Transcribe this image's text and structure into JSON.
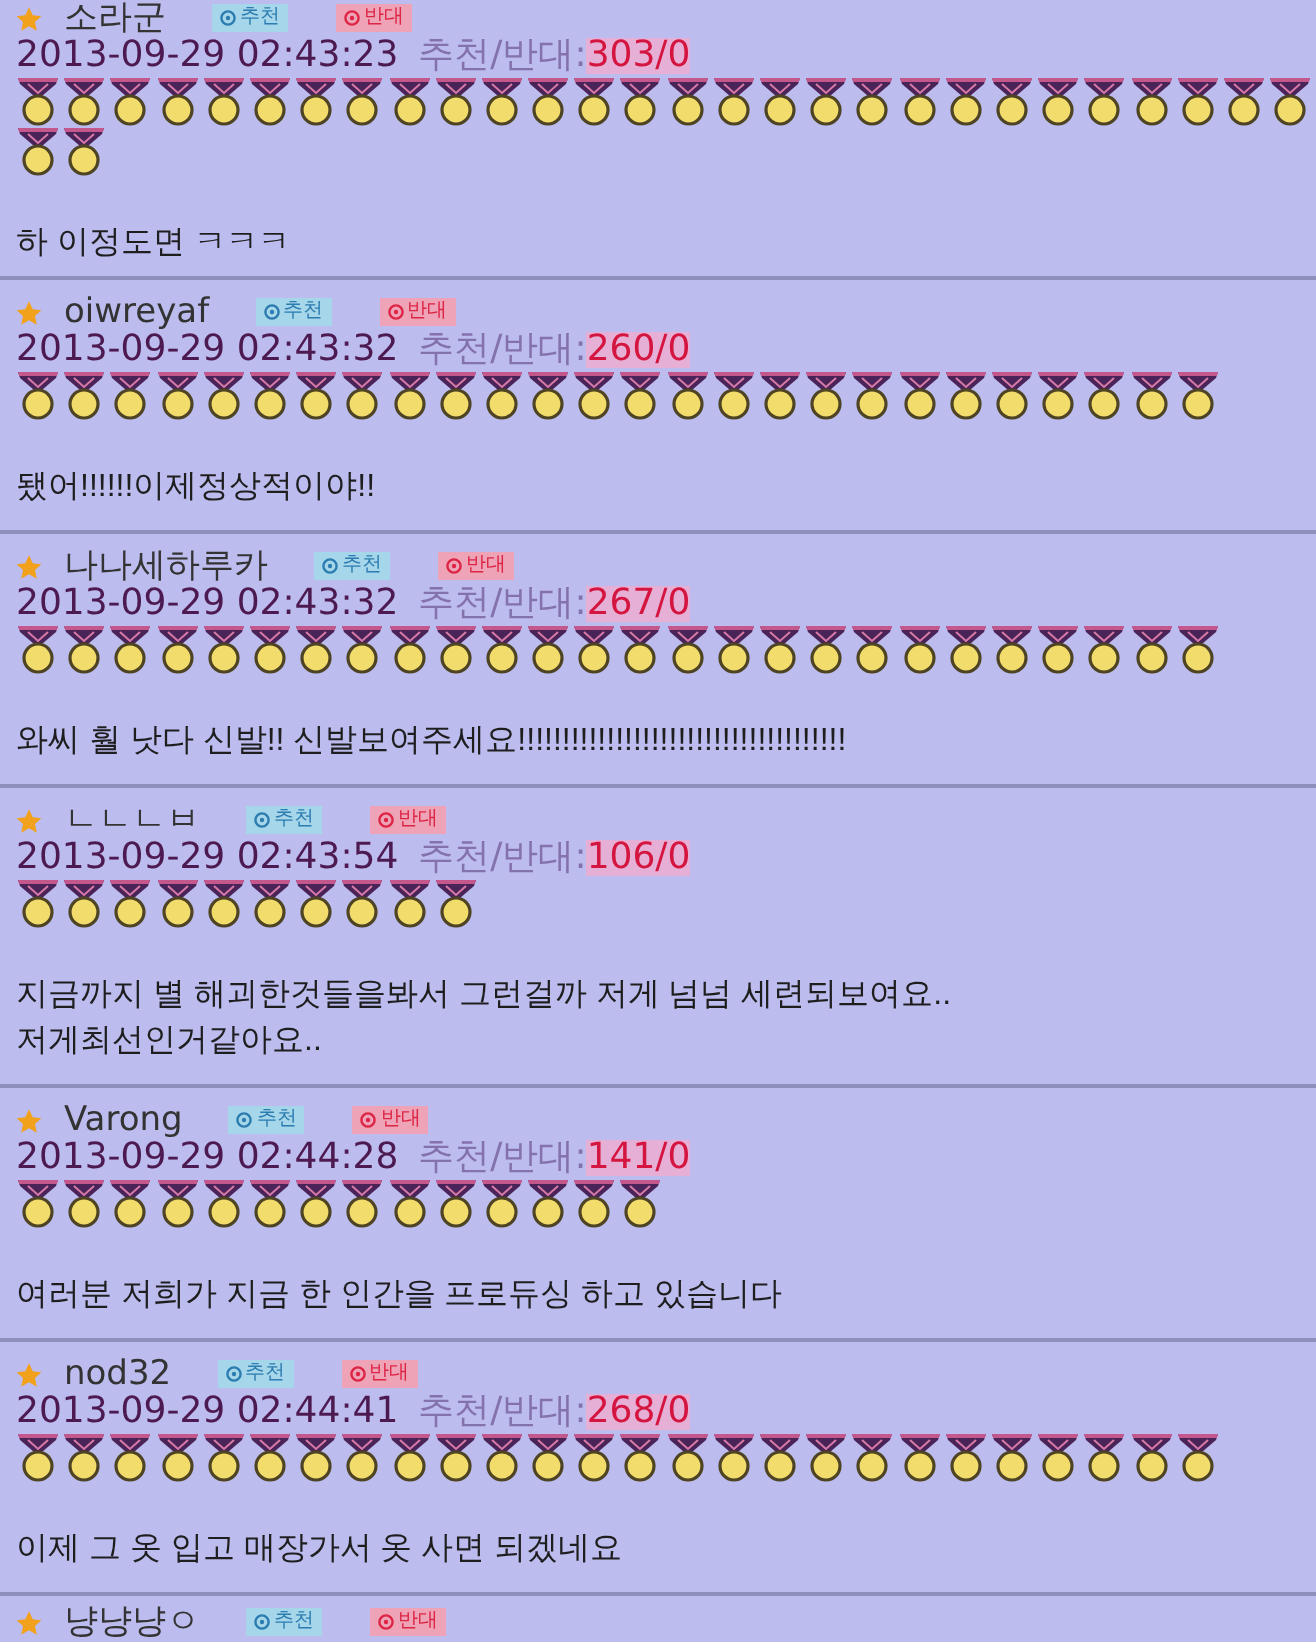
{
  "comments": [
    {
      "author": "소라군",
      "recommend": "추천",
      "oppose": "반대",
      "date": "2013-09-29 02:43:23",
      "votes_label": "추천/반대:",
      "votes": "303/0",
      "medals": [
        {
          "kind": "gold"
        },
        {
          "kind": "gold"
        },
        {
          "kind": "gold"
        },
        {
          "kind": "gold"
        },
        {
          "kind": "gold"
        },
        {
          "kind": "gold"
        },
        {
          "kind": "gold"
        },
        {
          "kind": "gold"
        },
        {
          "kind": "gold"
        },
        {
          "kind": "gold"
        },
        {
          "kind": "gold"
        },
        {
          "kind": "gold"
        },
        {
          "kind": "gold"
        },
        {
          "kind": "gold"
        },
        {
          "kind": "gold"
        },
        {
          "kind": "gold"
        },
        {
          "kind": "gold"
        },
        {
          "kind": "gold"
        },
        {
          "kind": "gold"
        },
        {
          "kind": "gold"
        },
        {
          "kind": "gold"
        },
        {
          "kind": "gold"
        },
        {
          "kind": "gold"
        },
        {
          "kind": "gold"
        },
        {
          "kind": "gold"
        },
        {
          "kind": "gold"
        },
        {
          "kind": "gold"
        },
        {
          "kind": "gold"
        },
        {
          "kind": "gold"
        },
        {
          "kind": "gold"
        }
      ],
      "text": "하 이정도면 ㅋㅋㅋ"
    },
    {
      "author": "oiwreyaf",
      "recommend": "추천",
      "oppose": "반대",
      "date": "2013-09-29 02:43:32",
      "votes_label": "추천/반대:",
      "votes": "260/0",
      "medals": [
        {
          "kind": "gold"
        },
        {
          "kind": "gold"
        },
        {
          "kind": "gold"
        },
        {
          "kind": "gold"
        },
        {
          "kind": "gold"
        },
        {
          "kind": "gold"
        },
        {
          "kind": "gold"
        },
        {
          "kind": "gold"
        },
        {
          "kind": "gold"
        },
        {
          "kind": "gold"
        },
        {
          "kind": "gold"
        },
        {
          "kind": "gold"
        },
        {
          "kind": "gold"
        },
        {
          "kind": "gold"
        },
        {
          "kind": "gold"
        },
        {
          "kind": "gold"
        },
        {
          "kind": "gold"
        },
        {
          "kind": "gold"
        },
        {
          "kind": "gold"
        },
        {
          "kind": "gold"
        },
        {
          "kind": "gold"
        },
        {
          "kind": "gold"
        },
        {
          "kind": "gold"
        },
        {
          "kind": "gold"
        },
        {
          "kind": "gold"
        },
        {
          "kind": "gold"
        }
      ],
      "text": "됐어!!!!!!이제정상적이야!!"
    },
    {
      "author": "나나세하루카",
      "recommend": "추천",
      "oppose": "반대",
      "date": "2013-09-29 02:43:32",
      "votes_label": "추천/반대:",
      "votes": "267/0",
      "medals": [
        {
          "kind": "gold"
        },
        {
          "kind": "gold"
        },
        {
          "kind": "gold"
        },
        {
          "kind": "gold"
        },
        {
          "kind": "gold"
        },
        {
          "kind": "gold"
        },
        {
          "kind": "gold"
        },
        {
          "kind": "gold"
        },
        {
          "kind": "gold"
        },
        {
          "kind": "gold"
        },
        {
          "kind": "gold"
        },
        {
          "kind": "gold"
        },
        {
          "kind": "gold"
        },
        {
          "kind": "gold"
        },
        {
          "kind": "gold"
        },
        {
          "kind": "gold"
        },
        {
          "kind": "gold"
        },
        {
          "kind": "gold"
        },
        {
          "kind": "gold"
        },
        {
          "kind": "gold"
        },
        {
          "kind": "gold"
        },
        {
          "kind": "gold"
        },
        {
          "kind": "gold"
        },
        {
          "kind": "gold"
        },
        {
          "kind": "gold"
        },
        {
          "kind": "gold"
        }
      ],
      "text": "와씨 훨 낫다 신발!! 신발보여주세요!!!!!!!!!!!!!!!!!!!!!!!!!!!!!!!!!!!!!"
    },
    {
      "author": "ㄴㄴㄴㅂ",
      "recommend": "추천",
      "oppose": "반대",
      "date": "2013-09-29 02:43:54",
      "votes_label": "추천/반대:",
      "votes": "106/0",
      "medals": [
        {
          "kind": "gold"
        },
        {
          "kind": "gold"
        },
        {
          "kind": "gold"
        },
        {
          "kind": "gold"
        },
        {
          "kind": "gold"
        },
        {
          "kind": "gold"
        },
        {
          "kind": "gold"
        },
        {
          "kind": "gold"
        },
        {
          "kind": "gold"
        },
        {
          "kind": "gold"
        }
      ],
      "text": "지금까지 별 해괴한것들을봐서 그런걸까 저게 넘넘 세련되보여요..\n저게최선인거같아요.."
    },
    {
      "author": "Varong",
      "recommend": "추천",
      "oppose": "반대",
      "date": "2013-09-29 02:44:28",
      "votes_label": "추천/반대:",
      "votes": "141/0",
      "medals": [
        {
          "kind": "gold"
        },
        {
          "kind": "gold"
        },
        {
          "kind": "gold"
        },
        {
          "kind": "gold"
        },
        {
          "kind": "gold"
        },
        {
          "kind": "gold"
        },
        {
          "kind": "gold"
        },
        {
          "kind": "gold"
        },
        {
          "kind": "gold"
        },
        {
          "kind": "gold"
        },
        {
          "kind": "gold"
        },
        {
          "kind": "gold"
        },
        {
          "kind": "gold"
        },
        {
          "kind": "gold"
        }
      ],
      "text": "여러분 저희가 지금 한 인간을 프로듀싱 하고 있습니다"
    },
    {
      "author": "nod32",
      "recommend": "추천",
      "oppose": "반대",
      "date": "2013-09-29 02:44:41",
      "votes_label": "추천/반대:",
      "votes": "268/0",
      "medals": [
        {
          "kind": "gold"
        },
        {
          "kind": "gold"
        },
        {
          "kind": "gold"
        },
        {
          "kind": "gold"
        },
        {
          "kind": "gold"
        },
        {
          "kind": "gold"
        },
        {
          "kind": "gold"
        },
        {
          "kind": "gold"
        },
        {
          "kind": "gold"
        },
        {
          "kind": "gold"
        },
        {
          "kind": "gold"
        },
        {
          "kind": "gold"
        },
        {
          "kind": "gold"
        },
        {
          "kind": "gold"
        },
        {
          "kind": "gold"
        },
        {
          "kind": "gold"
        },
        {
          "kind": "gold"
        },
        {
          "kind": "gold"
        },
        {
          "kind": "gold"
        },
        {
          "kind": "gold"
        },
        {
          "kind": "gold"
        },
        {
          "kind": "gold"
        },
        {
          "kind": "gold"
        },
        {
          "kind": "gold"
        },
        {
          "kind": "gold"
        },
        {
          "kind": "gold"
        }
      ],
      "text": "이제 그 옷 입고 매장가서 옷 사면 되겠네요"
    },
    {
      "author": "냥냥냥ㅇ",
      "recommend": "추천",
      "oppose": "반대"
    }
  ]
}
